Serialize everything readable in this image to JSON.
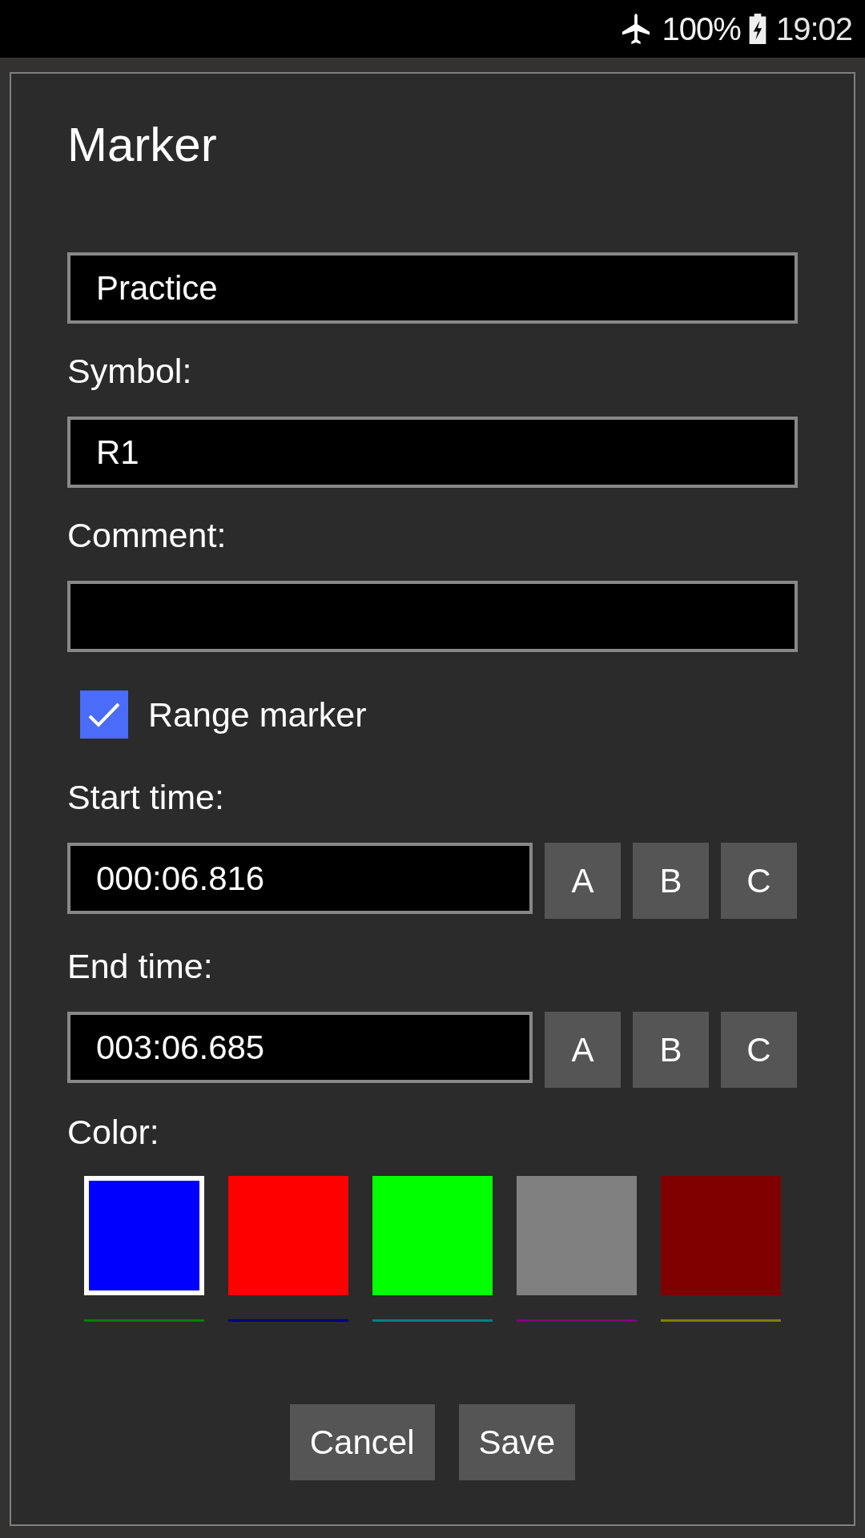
{
  "status_bar": {
    "battery": "100%",
    "time": "19:02"
  },
  "dialog": {
    "title": "Marker",
    "name_field": {
      "value": "Practice"
    },
    "symbol": {
      "label": "Symbol:",
      "value": "R1"
    },
    "comment": {
      "label": "Comment:"
    },
    "range_marker": {
      "label": "Range marker",
      "checked": true
    },
    "time_fields": [
      {
        "label": "Start time:",
        "value": "000:06.816",
        "buttons": [
          "A",
          "B",
          "C"
        ]
      },
      {
        "label": "End time:",
        "value": "003:06.685",
        "buttons": [
          "A",
          "B",
          "C"
        ]
      }
    ],
    "color": {
      "label": "Color:",
      "swatches": [
        {
          "color": "#0000ff",
          "selected": true,
          "underline": {
            "color": "#008000"
          }
        },
        {
          "color": "#ff0000",
          "selected": false,
          "underline": {
            "color": "#000080"
          }
        },
        {
          "color": "#00ff00",
          "selected": false,
          "underline": {
            "color": "#008080"
          }
        },
        {
          "color": "#808080",
          "selected": false,
          "underline": {
            "color": "#800080"
          }
        },
        {
          "color": "#800000",
          "selected": false,
          "underline": {
            "color": "#808000"
          }
        }
      ]
    },
    "buttons": [
      "Cancel",
      "Save"
    ]
  }
}
